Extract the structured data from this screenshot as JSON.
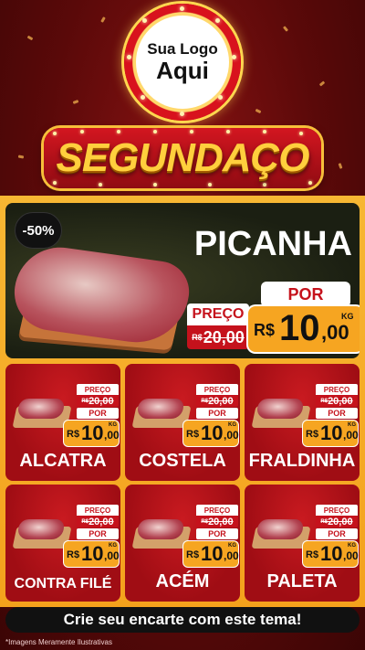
{
  "logo": {
    "line1": "Sua Logo",
    "line2": "Aqui"
  },
  "title": "SEGUNDAÇO",
  "featured": {
    "discount": "-50%",
    "name": "PICANHA",
    "preco_label": "PREÇO",
    "old_currency": "R$",
    "old_price": "20,00",
    "por_label": "POR",
    "currency": "R$",
    "price_int": "10",
    "price_cents": ",00",
    "unit": "KG"
  },
  "products": [
    {
      "name": "ALCATRA",
      "preco_label": "PREÇO",
      "old_currency": "R$",
      "old_price": "20,00",
      "por_label": "POR",
      "currency": "R$",
      "price_int": "10",
      "price_cents": ",00",
      "unit": "KG"
    },
    {
      "name": "COSTELA",
      "preco_label": "PREÇO",
      "old_currency": "R$",
      "old_price": "20,00",
      "por_label": "POR",
      "currency": "R$",
      "price_int": "10",
      "price_cents": ",00",
      "unit": "KG"
    },
    {
      "name": "FRALDINHA",
      "preco_label": "PREÇO",
      "old_currency": "R$",
      "old_price": "20,00",
      "por_label": "POR",
      "currency": "R$",
      "price_int": "10",
      "price_cents": ",00",
      "unit": "KG"
    },
    {
      "name": "CONTRA FILÉ",
      "preco_label": "PREÇO",
      "old_currency": "R$",
      "old_price": "20,00",
      "por_label": "POR",
      "currency": "R$",
      "price_int": "10",
      "price_cents": ",00",
      "unit": "KG"
    },
    {
      "name": "ACÉM",
      "preco_label": "PREÇO",
      "old_currency": "R$",
      "old_price": "20,00",
      "por_label": "POR",
      "currency": "R$",
      "price_int": "10",
      "price_cents": ",00",
      "unit": "KG"
    },
    {
      "name": "PALETA",
      "preco_label": "PREÇO",
      "old_currency": "R$",
      "old_price": "20,00",
      "por_label": "POR",
      "currency": "R$",
      "price_int": "10",
      "price_cents": ",00",
      "unit": "KG"
    }
  ],
  "footer": {
    "cta": "Crie seu encarte com este tema!",
    "disclaimer": "*Imagens Meramente Ilustrativas"
  },
  "colors": {
    "red": "#c5121c",
    "orange": "#f6a521",
    "gold": "#ffcf3d",
    "dark": "#111111"
  }
}
